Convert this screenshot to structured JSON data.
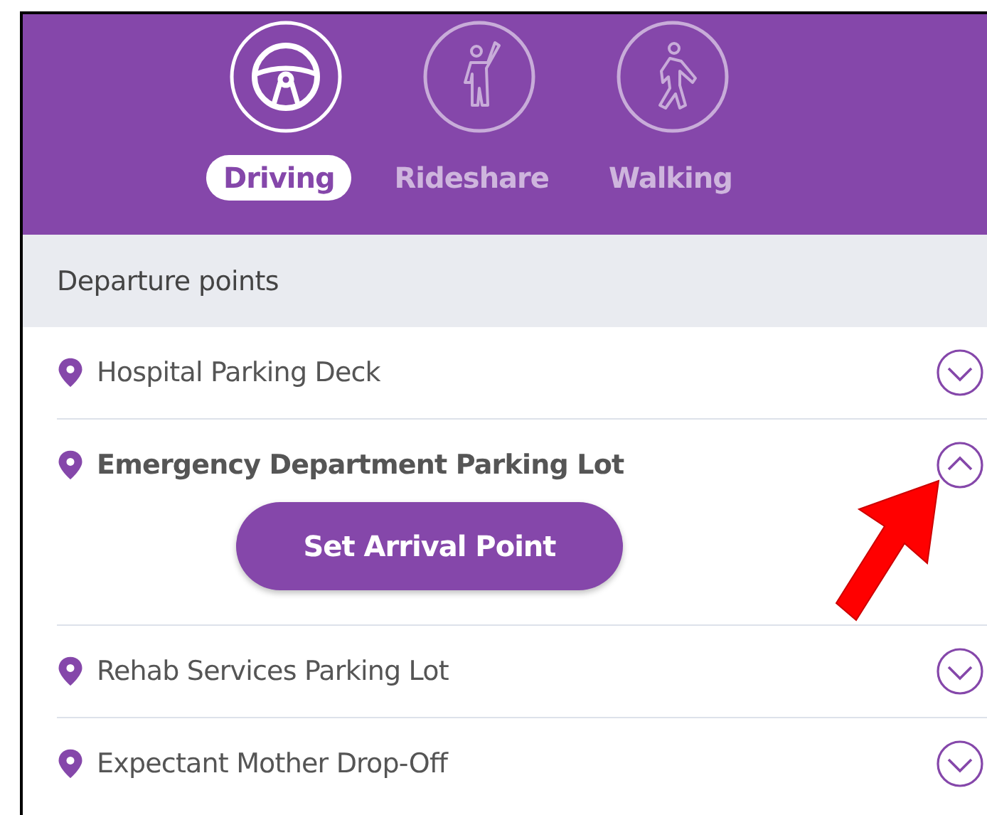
{
  "modes": [
    {
      "kind": "driving",
      "label": "Driving",
      "selected": true
    },
    {
      "kind": "rideshare",
      "label": "Rideshare",
      "selected": false
    },
    {
      "kind": "walking",
      "label": "Walking",
      "selected": false
    }
  ],
  "section": {
    "title": "Departure points"
  },
  "locations": [
    {
      "name": "Hospital Parking Deck",
      "expanded": false
    },
    {
      "name": "Emergency Department Parking Lot",
      "expanded": true,
      "action": "Set Arrival Point"
    },
    {
      "name": "Rehab Services Parking Lot",
      "expanded": false
    },
    {
      "name": "Expectant Mother Drop-Off",
      "expanded": false
    }
  ]
}
